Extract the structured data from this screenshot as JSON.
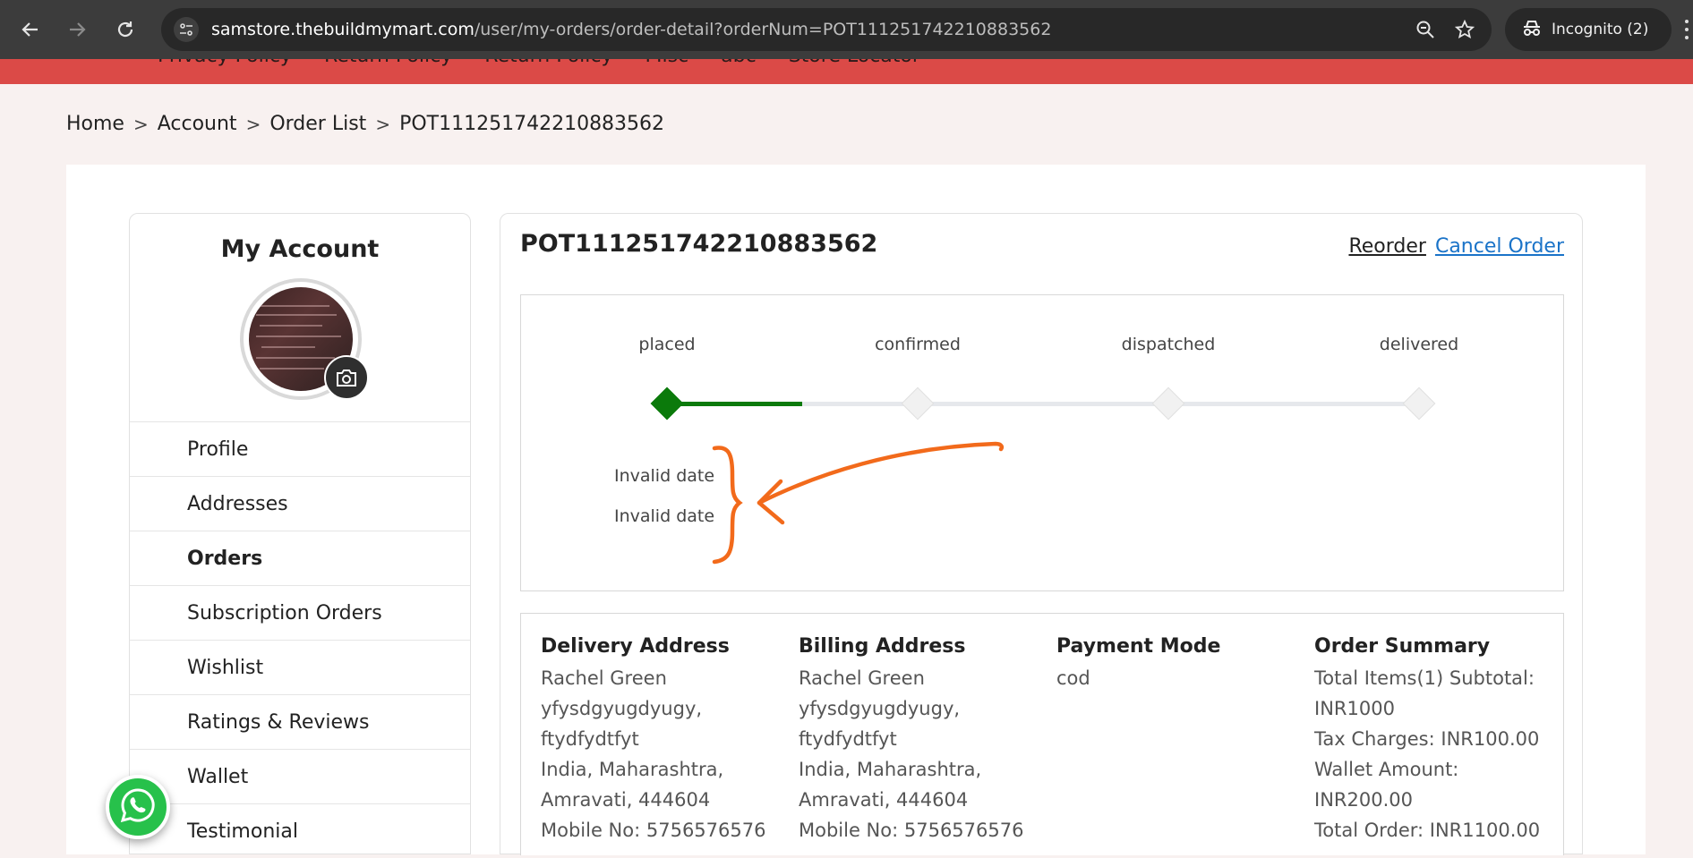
{
  "browser": {
    "url_host": "samstore.thebuildmymart.com",
    "url_path": "/user/my-orders/order-detail?orderNum=POT111251742210883562",
    "incognito_label": "Incognito (2)",
    "icons": [
      "back-icon",
      "forward-icon",
      "reload-icon",
      "site-info-icon",
      "zoom-icon",
      "bookmark-star-icon",
      "incognito-icon",
      "menu-icon"
    ]
  },
  "site_nav": {
    "links": [
      "Privacy Policy",
      "Return Policy",
      "Return Policy",
      "Misc",
      "abc",
      "Store Locator"
    ],
    "color": "#db4a47"
  },
  "breadcrumb": {
    "items": [
      "Home",
      "Account",
      "Order List",
      "POT111251742210883562"
    ],
    "separator": ">"
  },
  "sidebar": {
    "title": "My Account",
    "menu": [
      {
        "label": "Profile",
        "active": false
      },
      {
        "label": "Addresses",
        "active": false
      },
      {
        "label": "Orders",
        "active": true
      },
      {
        "label": "Subscription Orders",
        "active": false
      },
      {
        "label": "Wishlist",
        "active": false
      },
      {
        "label": "Ratings & Reviews",
        "active": false
      },
      {
        "label": "Wallet",
        "active": false
      },
      {
        "label": "Testimonial",
        "active": false
      }
    ]
  },
  "order": {
    "number": "POT111251742210883562",
    "reorder_label": "Reorder",
    "cancel_label": "Cancel Order",
    "steps": [
      {
        "label": "placed",
        "done": true
      },
      {
        "label": "confirmed",
        "done": false
      },
      {
        "label": "dispatched",
        "done": false
      },
      {
        "label": "delivered",
        "done": false
      }
    ],
    "progress_fraction": 0.18,
    "dates": [
      "Invalid date",
      "Invalid date"
    ],
    "status_color": "#0b7a0b"
  },
  "details": {
    "delivery": {
      "heading": "Delivery Address",
      "lines": [
        "Rachel Green",
        "yfysdgyugdyugy,",
        "ftydfydtfyt",
        "India, Maharashtra,",
        "Amravati, 444604",
        "Mobile No: 5756576576"
      ]
    },
    "billing": {
      "heading": "Billing Address",
      "lines": [
        "Rachel Green",
        "yfysdgyugdyugy,",
        "ftydfydtfyt",
        "India, Maharashtra,",
        "Amravati, 444604",
        "Mobile No: 5756576576"
      ]
    },
    "payment": {
      "heading": "Payment Mode",
      "lines": [
        "cod"
      ]
    },
    "summary": {
      "heading": "Order Summary",
      "lines": [
        "Total Items(1) Subtotal:",
        "INR1000",
        "Tax Charges: INR100.00",
        "Wallet Amount:",
        "INR200.00",
        "Total Order: INR1100.00"
      ]
    }
  },
  "annotation_color": "#f26a1b"
}
